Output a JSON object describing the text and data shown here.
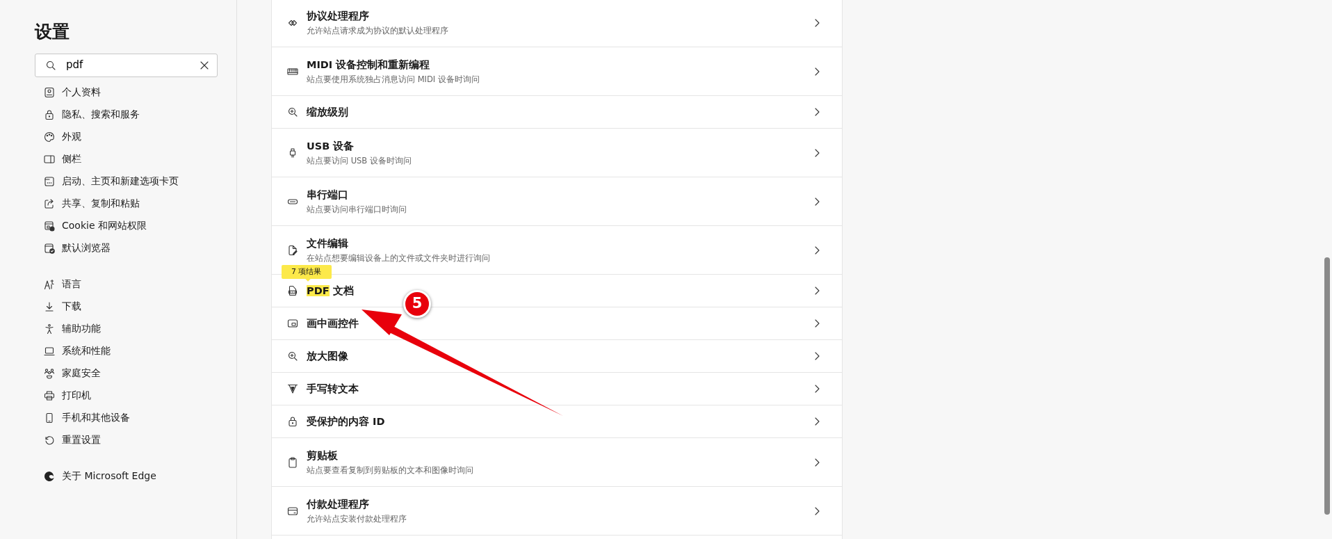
{
  "sidebar": {
    "title": "设置",
    "search": {
      "value": "pdf"
    },
    "groups": [
      [
        {
          "label": "个人资料"
        },
        {
          "label": "隐私、搜索和服务"
        },
        {
          "label": "外观"
        },
        {
          "label": "侧栏"
        },
        {
          "label": "启动、主页和新建选项卡页"
        },
        {
          "label": "共享、复制和粘贴"
        },
        {
          "label": "Cookie 和网站权限"
        },
        {
          "label": "默认浏览器"
        }
      ],
      [
        {
          "label": "语言"
        },
        {
          "label": "下载"
        },
        {
          "label": "辅助功能"
        },
        {
          "label": "系统和性能"
        },
        {
          "label": "家庭安全"
        },
        {
          "label": "打印机"
        },
        {
          "label": "手机和其他设备"
        },
        {
          "label": "重置设置"
        }
      ],
      [
        {
          "label": "关于 Microsoft Edge"
        }
      ]
    ]
  },
  "permissions": [
    {
      "title": "协议处理程序",
      "description": "允许站点请求成为协议的默认处理程序"
    },
    {
      "title": "MIDI 设备控制和重新编程",
      "description": "站点要使用系统独占消息访问 MIDI 设备时询问"
    },
    {
      "title": "缩放级别"
    },
    {
      "title": "USB 设备",
      "description": "站点要访问 USB 设备时询问"
    },
    {
      "title": "串行端口",
      "description": "站点要访问串行端口时询问"
    },
    {
      "title": "文件编辑",
      "description": "在站点想要编辑设备上的文件或文件夹时进行询问"
    },
    {
      "title": "**PDF** 文档",
      "match_tooltip": "7 项结果"
    },
    {
      "title": "画中画控件"
    },
    {
      "title": "放大图像"
    },
    {
      "title": "手写转文本"
    },
    {
      "title": "受保护的内容 ID"
    },
    {
      "title": "剪贴板",
      "description": "站点要查看复制到剪贴板的文本和图像时询问"
    },
    {
      "title": "付款处理程序",
      "description": "允许站点安装付款处理程序"
    }
  ],
  "annotation": {
    "label": "5"
  }
}
